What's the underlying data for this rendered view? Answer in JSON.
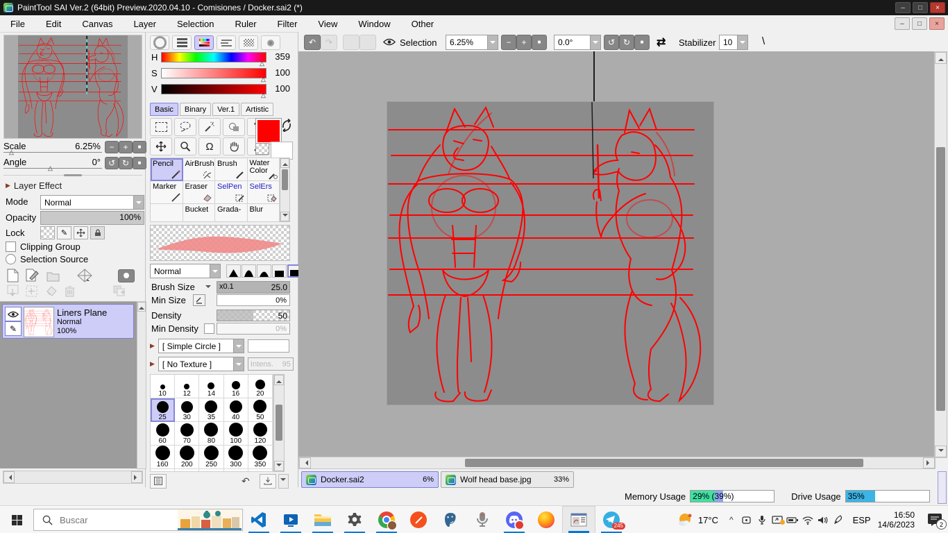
{
  "window": {
    "title": "PaintTool SAI Ver.2 (64bit) Preview.2020.04.10 - Comisiones / Docker.sai2 (*)"
  },
  "menubar": {
    "items": [
      "File",
      "Edit",
      "Canvas",
      "Layer",
      "Selection",
      "Ruler",
      "Filter",
      "View",
      "Window",
      "Other"
    ]
  },
  "toolbar": {
    "selection_label": "Selection",
    "zoom_value": "6.25%",
    "angle_value": "0.0°",
    "stabilizer_label": "Stabilizer",
    "stabilizer_value": "10"
  },
  "navigator": {
    "scale_label": "Scale",
    "scale_value": "6.25%",
    "angle_label": "Angle",
    "angle_value": "0°"
  },
  "layer_panel": {
    "effect_header": "Layer Effect",
    "mode_label": "Mode",
    "mode_value": "Normal",
    "opacity_label": "Opacity",
    "opacity_value": "100%",
    "lock_label": "Lock",
    "clipping_label": "Clipping Group",
    "selection_source_label": "Selection Source",
    "layers": [
      {
        "name": "Liners Plane",
        "mode": "Normal",
        "opacity": "100%"
      }
    ]
  },
  "color_panel": {
    "h_label": "H",
    "h_value": "359",
    "s_label": "S",
    "s_value": "100",
    "v_label": "V",
    "v_value": "100"
  },
  "tool_tabs": {
    "items": [
      "Basic",
      "Binary",
      "Ver.1",
      "Artistic"
    ]
  },
  "brush_grid": {
    "row1": [
      "Pencil",
      "AirBrush",
      "Brush",
      "Water Color"
    ],
    "row2": [
      "Marker",
      "Eraser",
      "SelPen",
      "SelErs"
    ],
    "row3": [
      "",
      "Bucket",
      "Grada-",
      "Blur"
    ]
  },
  "brush_settings": {
    "blend_mode": "Normal",
    "size_label": "Brush Size",
    "size_scale": "x0.1",
    "size_value": "25.0",
    "min_size_label": "Min Size",
    "min_size_value": "0%",
    "density_label": "Density",
    "density_value": "50",
    "min_density_label": "Min Density",
    "min_density_value": "0%",
    "shape_value": "[ Simple Circle ]",
    "texture_value": "[ No Texture ]",
    "texture_label": "Intens.",
    "texture_intensity": "95"
  },
  "size_presets": {
    "values": [
      "10",
      "12",
      "14",
      "16",
      "20",
      "25",
      "30",
      "35",
      "40",
      "50",
      "60",
      "70",
      "80",
      "100",
      "120",
      "160",
      "200",
      "250",
      "300",
      "350"
    ],
    "selected": "25"
  },
  "document_tabs": {
    "tabs": [
      {
        "name": "Docker.sai2",
        "zoom": "6%"
      },
      {
        "name": "Wolf head base.jpg",
        "zoom": "33%"
      }
    ]
  },
  "status_bar": {
    "memory_label": "Memory Usage",
    "memory_value": "29% (39%)",
    "drive_label": "Drive Usage",
    "drive_value": "35%"
  },
  "taskbar": {
    "search_placeholder": "Buscar",
    "weather_temp": "17°C",
    "language": "ESP",
    "time": "16:50",
    "date": "14/6/2023",
    "telegram_badge": "245",
    "notification_badge": "2"
  },
  "icons": {
    "minimize": "–",
    "maximize": "□",
    "close": "×",
    "undo": "↶",
    "redo": "↷",
    "rotate_ccw": "↺",
    "rotate_cw": "↻",
    "reset": "■",
    "minus": "−",
    "plus": "+",
    "swap": "⇄",
    "omega": "Ω",
    "text_tool": "T",
    "tri_right": "▶",
    "marker_up": "△",
    "backslash": "\\",
    "caret": "^",
    "pencil": "✎"
  },
  "colors": {
    "accent_red": "#ff0000",
    "selection_highlight": "#cdcdf8",
    "memory_green": "#41e0a3",
    "memory_blue": "#8fa8f2",
    "drive_cyan": "#3cb4e6",
    "taskbar_indicator": "#0078d7"
  }
}
